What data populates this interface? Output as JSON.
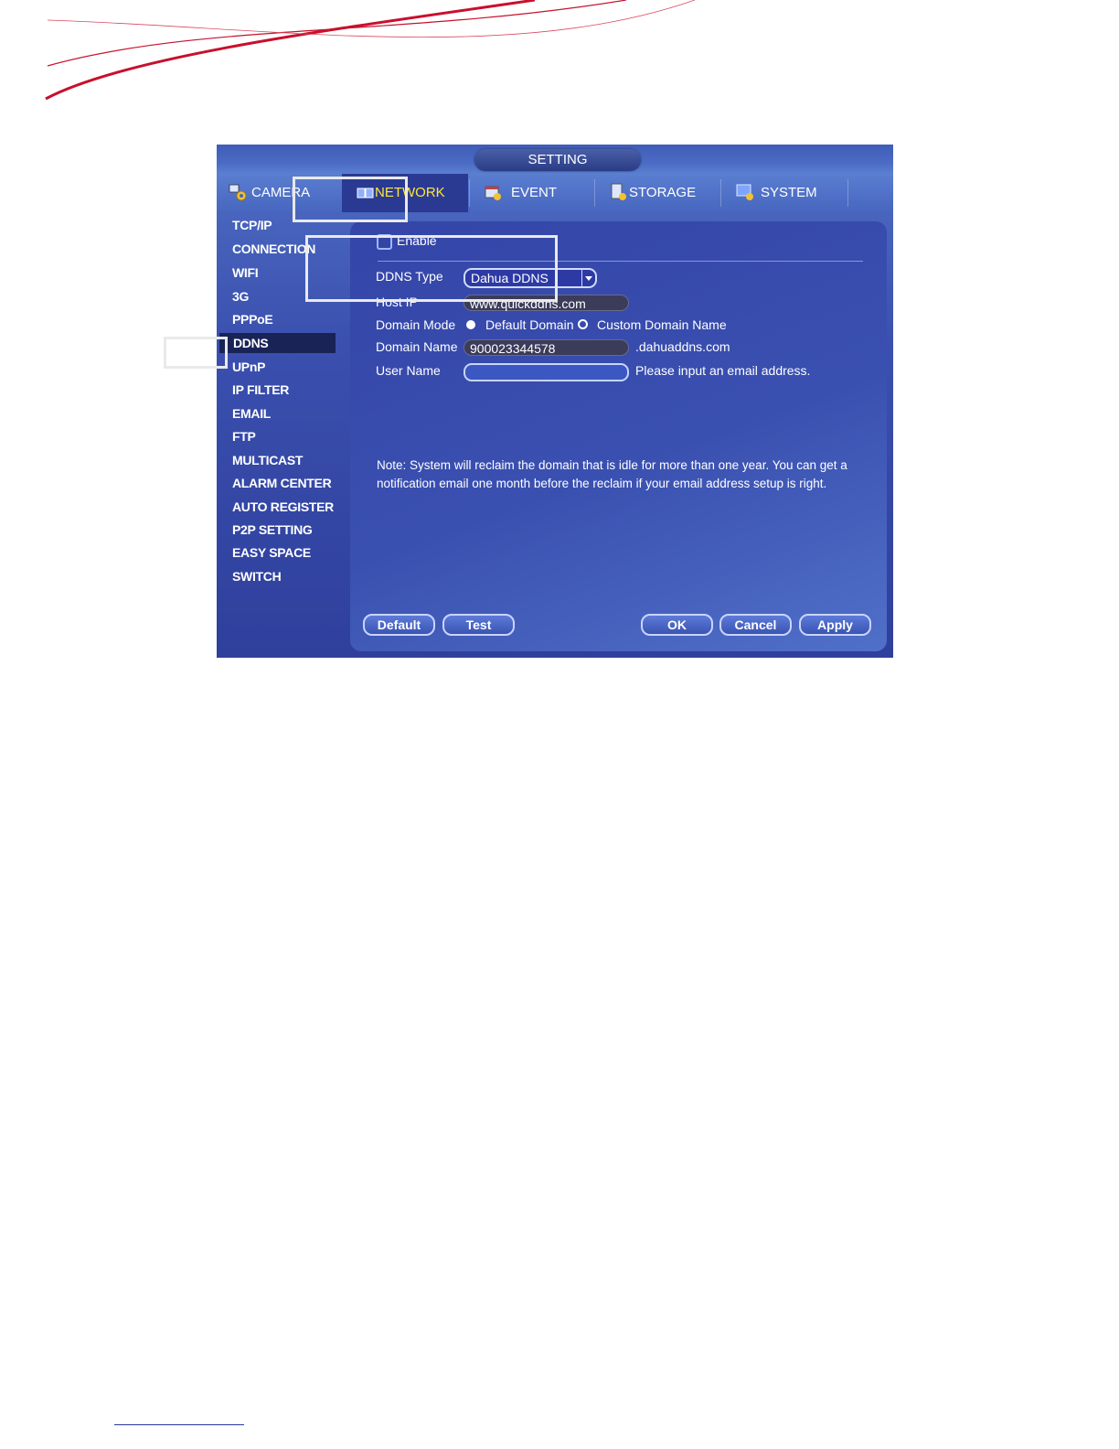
{
  "window": {
    "title": "SETTING"
  },
  "tabs": [
    {
      "label": "CAMERA",
      "icon": "camera-gear-icon",
      "active": false
    },
    {
      "label": "NETWORK",
      "icon": "network-icon",
      "active": true
    },
    {
      "label": "EVENT",
      "icon": "event-icon",
      "active": false
    },
    {
      "label": "STORAGE",
      "icon": "storage-icon",
      "active": false
    },
    {
      "label": "SYSTEM",
      "icon": "system-icon",
      "active": false
    }
  ],
  "sidebar": {
    "items": [
      {
        "label": "TCP/IP"
      },
      {
        "label": "CONNECTION"
      },
      {
        "label": "WIFI"
      },
      {
        "label": "3G"
      },
      {
        "label": "PPPoE"
      },
      {
        "label": "DDNS"
      },
      {
        "label": "UPnP"
      },
      {
        "label": "IP FILTER"
      },
      {
        "label": "EMAIL"
      },
      {
        "label": "FTP"
      },
      {
        "label": "MULTICAST"
      },
      {
        "label": "ALARM CENTER"
      },
      {
        "label": "AUTO REGISTER"
      },
      {
        "label": "P2P SETTING"
      },
      {
        "label": "EASY SPACE"
      },
      {
        "label": "SWITCH"
      }
    ],
    "active": "DDNS"
  },
  "form": {
    "enable_label": "Enable",
    "enable_checked": false,
    "ddns_type_label": "DDNS Type",
    "ddns_type_value": "Dahua DDNS",
    "host_ip_label": "Host IP",
    "host_ip_value": "www.quickddns.com",
    "domain_mode_label": "Domain Mode",
    "domain_mode_options": [
      "Default Domain",
      "Custom Domain Name"
    ],
    "domain_mode_selected": "Default Domain",
    "domain_name_label": "Domain Name",
    "domain_name_value": "900023344578",
    "domain_suffix": ".dahuaddns.com",
    "user_name_label": "User Name",
    "user_name_value": "",
    "user_name_hint": "Please input an email address.",
    "note_line1": "Note: System will reclaim the domain that is idle for more than one year. You can get a",
    "note_line2": "notification email one month before the reclaim if your email address setup is right."
  },
  "buttons": {
    "default": "Default",
    "test": "Test",
    "ok": "OK",
    "cancel": "Cancel",
    "apply": "Apply"
  },
  "colors": {
    "swoosh": "#c8102e",
    "active_tab_text": "#ffe63a",
    "panel_bg": "#3445a8"
  }
}
